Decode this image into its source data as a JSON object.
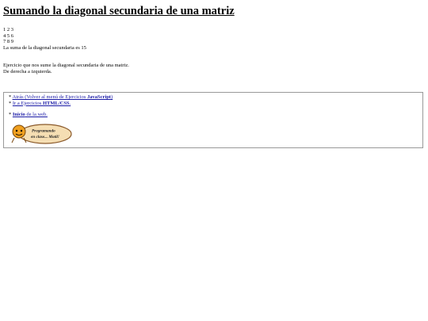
{
  "title": "Sumando la diagonal secundaria de una matriz",
  "matrix_rows": [
    "1 2 3",
    "4 5 6",
    "7 8 9"
  ],
  "result": "La suma de la diagonal secundaria es 15",
  "description": [
    "Ejercicio que nos sume la diagonal secundaria de una matriz.",
    "De derecha a izquierda."
  ],
  "nav": {
    "back_prefix": "Atrás (Volver al menú de Ejercicios ",
    "back_bold": "JavaScript",
    "back_suffix": ")",
    "html_prefix": " Ir a Ejercicios ",
    "html_bold": "HTML/CSS",
    "html_suffix": ".",
    "home_bold": " Inicio",
    "home_suffix": " de la web."
  },
  "logo_text": [
    "Programando",
    "en clase... Motil!"
  ],
  "colors": {
    "link": "#1a1aa6",
    "logo_fill": "#f5deb3",
    "logo_stroke": "#8b5a2b",
    "logo_accent": "#f0a020"
  }
}
